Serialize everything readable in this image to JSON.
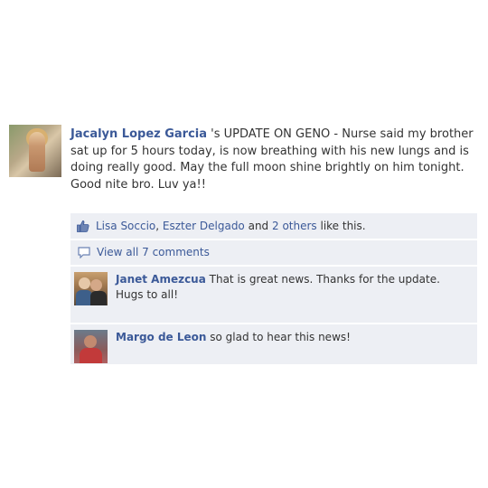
{
  "post": {
    "author": "Jacalyn Lopez Garcia",
    "text": " 's UPDATE ON GENO - Nurse said my brother sat up for 5 hours today, is now breathing with his new lungs and is doing really good. May the full moon shine brightly on him tonight. Good nite bro. Luv ya!!"
  },
  "likes": {
    "user1": "Lisa Soccio",
    "sep1": ", ",
    "user2": "Eszter Delgado",
    "and": " and ",
    "others": "2 others",
    "suffix": " like this."
  },
  "view_all_comments": "View all 7 comments",
  "comments": [
    {
      "author": "Janet Amezcua",
      "text": " That is great news. Thanks for the update. Hugs to all!"
    },
    {
      "author": "Margo de Leon",
      "text": " so glad to hear this news!"
    }
  ],
  "icons": [
    "thumbs-up-icon",
    "comment-icon"
  ],
  "colors": {
    "link": "#3b5998",
    "feedback_bg": "#edeff4",
    "text": "#333333"
  }
}
